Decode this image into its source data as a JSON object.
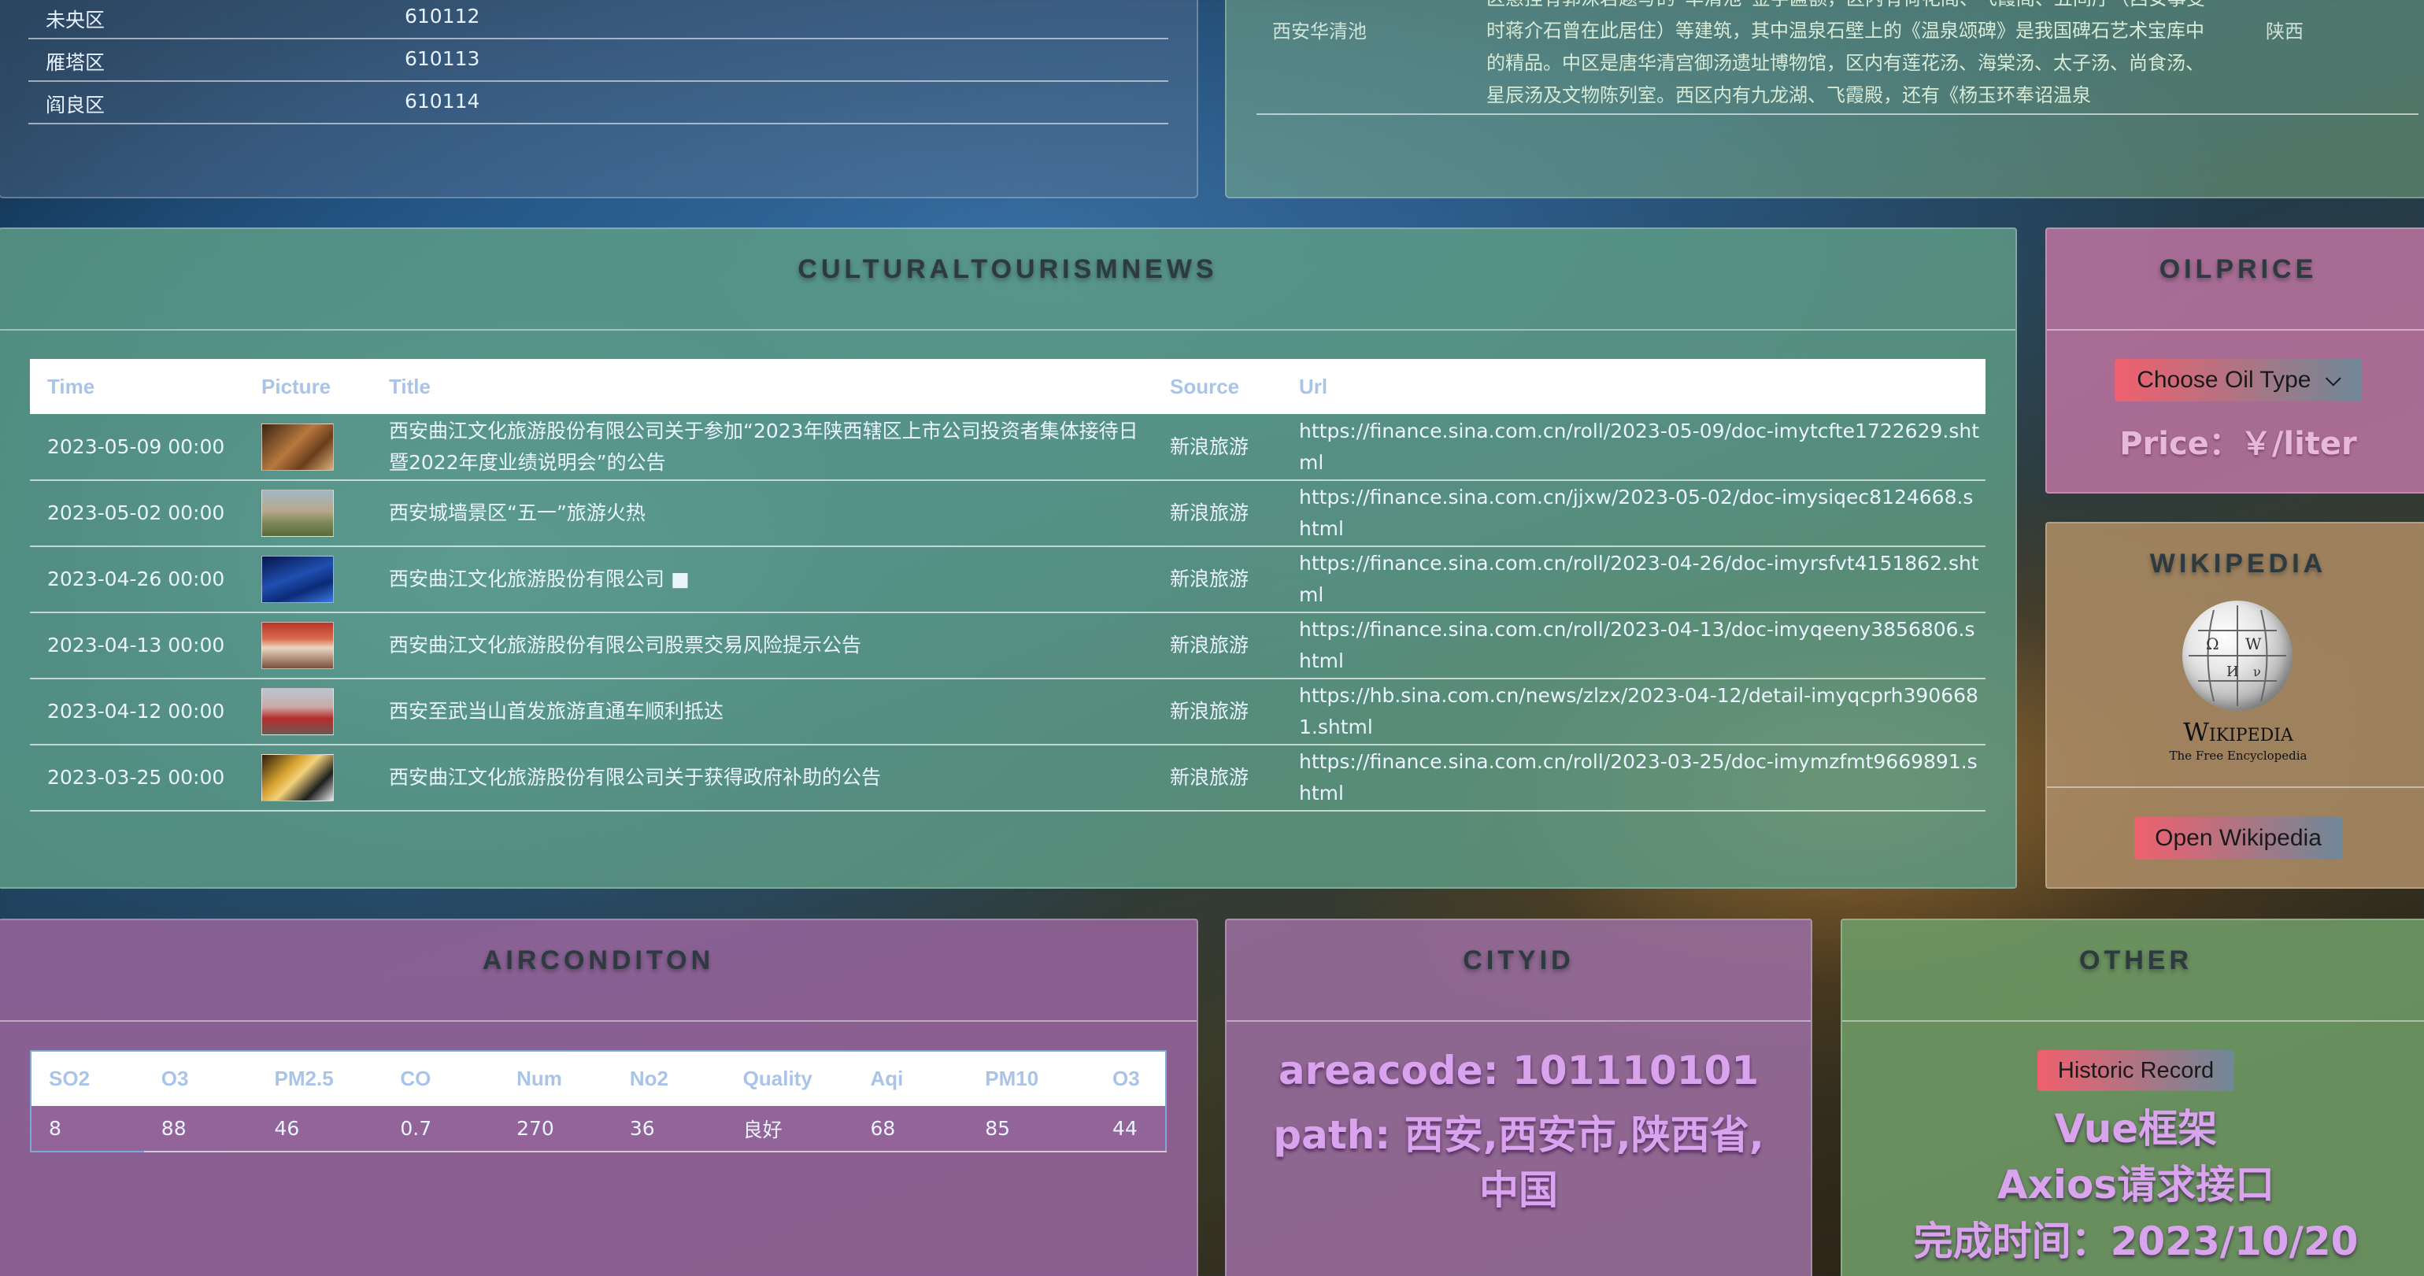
{
  "districts": [
    {
      "name": "未央区",
      "code": "610112"
    },
    {
      "name": "雁塔区",
      "code": "610113"
    },
    {
      "name": "阎良区",
      "code": "610114"
    }
  ],
  "attraction": {
    "name": "西安华清池",
    "description": "区悬挂有郭沫若题写的“华清池”金字匾额，区内有荷花阁、飞霞阁、五间厅（西安事变时蒋介石曾在此居住）等建筑，其中温泉石壁上的《温泉颂碑》是我国碑石艺术宝库中的精品。中区是唐华清宫御汤遗址博物馆，区内有莲花汤、海棠汤、太子汤、尚食汤、星辰汤及文物陈列室。西区内有九龙湖、飞霞殿，还有《杨玉环奉诏温泉",
    "province": "陕西"
  },
  "news": {
    "title": "CULTURALTOURISMNEWS",
    "columns": {
      "time": "Time",
      "picture": "Picture",
      "title": "Title",
      "source": "Source",
      "url": "Url"
    },
    "rows": [
      {
        "time": "2023-05-09 00:00",
        "title": "西安曲江文化旅游股份有限公司关于参加“2023年陕西辖区上市公司投资者集体接待日暨2022年度业绩说明会”的公告",
        "source": "新浪旅游",
        "url": "https://finance.sina.com.cn/roll/2023-05-09/doc-imytcfte1722629.shtml"
      },
      {
        "time": "2023-05-02 00:00",
        "title": "西安城墙景区“五一”旅游火热",
        "source": "新浪旅游",
        "url": "https://finance.sina.com.cn/jjxw/2023-05-02/doc-imysiqec8124668.shtml"
      },
      {
        "time": "2023-04-26 00:00",
        "title": "西安曲江文化旅游股份有限公司 ■",
        "source": "新浪旅游",
        "url": "https://finance.sina.com.cn/roll/2023-04-26/doc-imyrsfvt4151862.shtml"
      },
      {
        "time": "2023-04-13 00:00",
        "title": "西安曲江文化旅游股份有限公司股票交易风险提示公告",
        "source": "新浪旅游",
        "url": "https://finance.sina.com.cn/roll/2023-04-13/doc-imyqeeny3856806.shtml"
      },
      {
        "time": "2023-04-12 00:00",
        "title": "西安至武当山首发旅游直通车顺利抵达",
        "source": "新浪旅游",
        "url": "https://hb.sina.com.cn/news/zlzx/2023-04-12/detail-imyqcprh3906681.shtml"
      },
      {
        "time": "2023-03-25 00:00",
        "title": "西安曲江文化旅游股份有限公司关于获得政府补助的公告",
        "source": "新浪旅游",
        "url": "https://finance.sina.com.cn/roll/2023-03-25/doc-imymzfmt9669891.shtml"
      }
    ]
  },
  "oil": {
    "title": "OILPRICE",
    "choose_label": "Choose Oil Type",
    "price_label": "Price：￥/liter"
  },
  "wiki": {
    "title": "WIKIPEDIA",
    "logo_word": "Wikipedia",
    "logo_tagline": "The Free Encyclopedia",
    "button_label": "Open Wikipedia"
  },
  "air": {
    "title": "AIRCONDITON",
    "columns": [
      "SO2",
      "O3",
      "PM2.5",
      "CO",
      "Num",
      "No2",
      "Quality",
      "Aqi",
      "PM10",
      "O3"
    ],
    "values": [
      "8",
      "88",
      "46",
      "0.7",
      "270",
      "36",
      "良好",
      "68",
      "85",
      "44"
    ]
  },
  "city": {
    "title": "CITYID",
    "areacode": "areacode: 101110101",
    "path_line1": "path: 西安,西安市,陕西省,",
    "path_line2": "中国"
  },
  "other": {
    "title": "OTHER",
    "button_label": "Historic Record",
    "line1": "Vue框架",
    "line2": "Axios请求接口",
    "line3": "完成时间：2023/10/20"
  },
  "colors": {
    "news_panel": "#5f9e86",
    "oil_panel": "#b9739f",
    "wiki_panel": "#a88a64",
    "air_panel": "#93649a",
    "city_panel": "#966b9a",
    "other_panel": "#6f9a66",
    "button_gradient_start": "#f0606e",
    "button_gradient_end": "#6f8898"
  }
}
